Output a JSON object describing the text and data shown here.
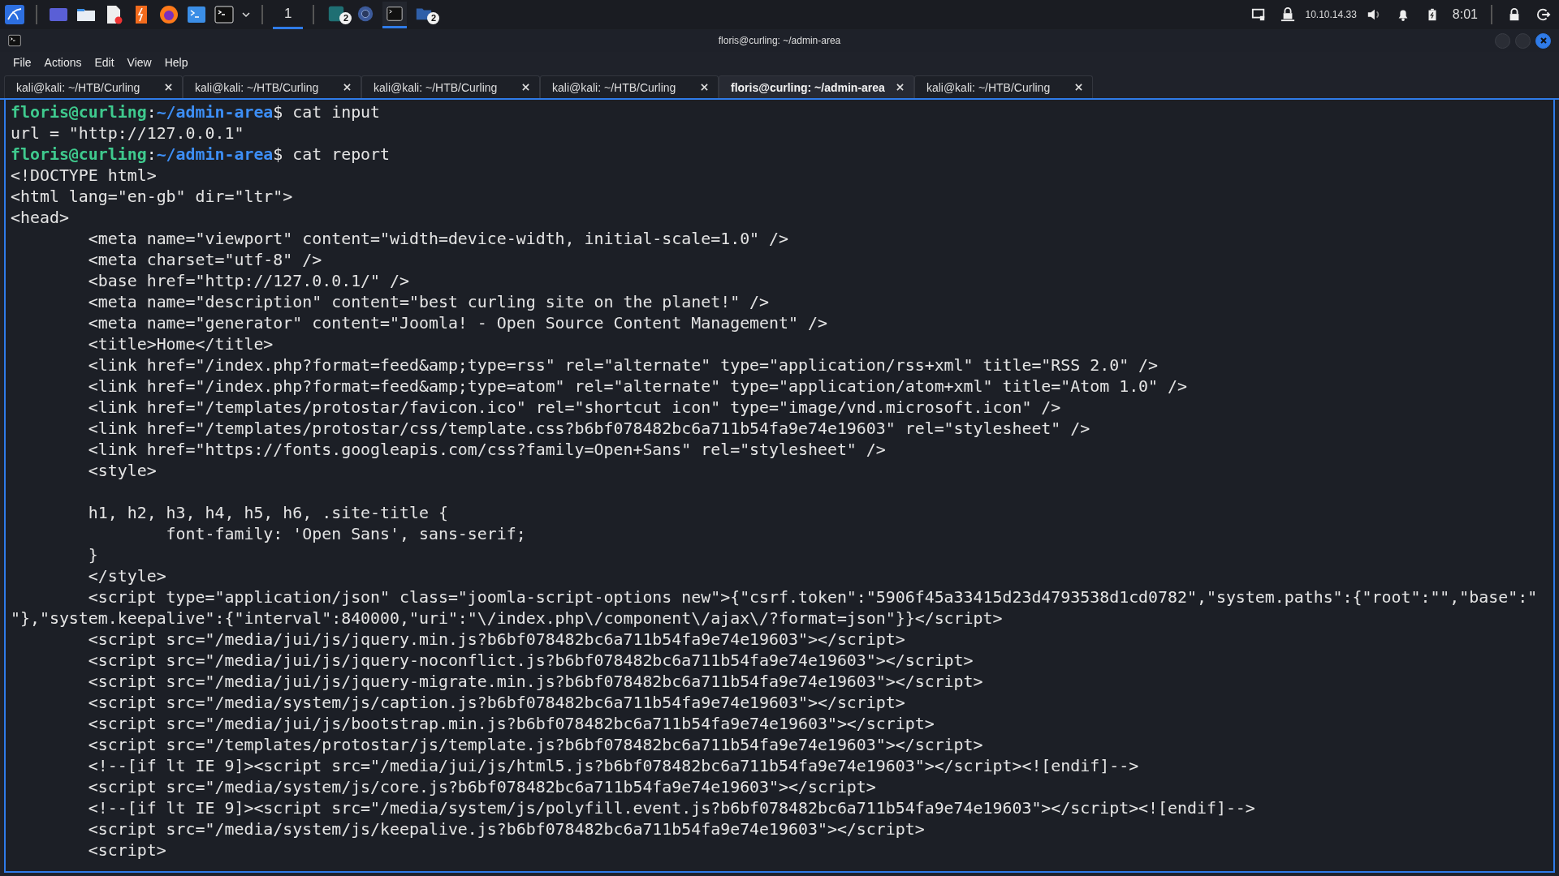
{
  "taskbar": {
    "workspace": "1",
    "tasks": [
      {
        "kind": "app",
        "active": false,
        "badge": "2"
      },
      {
        "kind": "browser",
        "active": false
      },
      {
        "kind": "terminal",
        "active": true
      },
      {
        "kind": "folder",
        "active": false,
        "badge": "2"
      }
    ],
    "tray": {
      "ip": "10.10.14.33",
      "clock": "8:01"
    }
  },
  "window": {
    "title": "floris@curling: ~/admin-area"
  },
  "menu": [
    "File",
    "Actions",
    "Edit",
    "View",
    "Help"
  ],
  "tabs": [
    {
      "label": "kali@kali: ~/HTB/Curling",
      "selected": false
    },
    {
      "label": "kali@kali: ~/HTB/Curling",
      "selected": false
    },
    {
      "label": "kali@kali: ~/HTB/Curling",
      "selected": false
    },
    {
      "label": "kali@kali: ~/HTB/Curling",
      "selected": false
    },
    {
      "label": "floris@curling: ~/admin-area",
      "selected": true
    },
    {
      "label": "kali@kali: ~/HTB/Curling",
      "selected": false
    }
  ],
  "terminal": {
    "lines": [
      {
        "kind": "prompt",
        "user": "floris@curling",
        "sep": ":",
        "path": "~/admin-area",
        "command": "$ cat input"
      },
      {
        "kind": "output",
        "text": "url = \"http://127.0.0.1\""
      },
      {
        "kind": "prompt",
        "user": "floris@curling",
        "sep": ":",
        "path": "~/admin-area",
        "command": "$ cat report"
      },
      {
        "kind": "output",
        "text": "<!DOCTYPE html>"
      },
      {
        "kind": "output",
        "text": "<html lang=\"en-gb\" dir=\"ltr\">"
      },
      {
        "kind": "output",
        "text": "<head>"
      },
      {
        "kind": "output",
        "text": "        <meta name=\"viewport\" content=\"width=device-width, initial-scale=1.0\" />"
      },
      {
        "kind": "output",
        "text": "        <meta charset=\"utf-8\" />"
      },
      {
        "kind": "output",
        "text": "        <base href=\"http://127.0.0.1/\" />"
      },
      {
        "kind": "output",
        "text": "        <meta name=\"description\" content=\"best curling site on the planet!\" />"
      },
      {
        "kind": "output",
        "text": "        <meta name=\"generator\" content=\"Joomla! - Open Source Content Management\" />"
      },
      {
        "kind": "output",
        "text": "        <title>Home</title>"
      },
      {
        "kind": "output",
        "text": "        <link href=\"/index.php?format=feed&amp;type=rss\" rel=\"alternate\" type=\"application/rss+xml\" title=\"RSS 2.0\" />"
      },
      {
        "kind": "output",
        "text": "        <link href=\"/index.php?format=feed&amp;type=atom\" rel=\"alternate\" type=\"application/atom+xml\" title=\"Atom 1.0\" />"
      },
      {
        "kind": "output",
        "text": "        <link href=\"/templates/protostar/favicon.ico\" rel=\"shortcut icon\" type=\"image/vnd.microsoft.icon\" />"
      },
      {
        "kind": "output",
        "text": "        <link href=\"/templates/protostar/css/template.css?b6bf078482bc6a711b54fa9e74e19603\" rel=\"stylesheet\" />"
      },
      {
        "kind": "output",
        "text": "        <link href=\"https://fonts.googleapis.com/css?family=Open+Sans\" rel=\"stylesheet\" />"
      },
      {
        "kind": "output",
        "text": "        <style>"
      },
      {
        "kind": "blank"
      },
      {
        "kind": "output",
        "text": "        h1, h2, h3, h4, h5, h6, .site-title {"
      },
      {
        "kind": "output",
        "text": "                font-family: 'Open Sans', sans-serif;"
      },
      {
        "kind": "output",
        "text": "        }"
      },
      {
        "kind": "output",
        "text": "        </style>"
      },
      {
        "kind": "output",
        "text": "        <script type=\"application/json\" class=\"joomla-script-options new\">{\"csrf.token\":\"5906f45a33415d23d4793538d1cd0782\",\"system.paths\":{\"root\":\"\",\"base\":\""
      },
      {
        "kind": "output",
        "text": "\"},\"system.keepalive\":{\"interval\":840000,\"uri\":\"\\/index.php\\/component\\/ajax\\/?format=json\"}}</script>"
      },
      {
        "kind": "output",
        "text": "        <script src=\"/media/jui/js/jquery.min.js?b6bf078482bc6a711b54fa9e74e19603\"></script>"
      },
      {
        "kind": "output",
        "text": "        <script src=\"/media/jui/js/jquery-noconflict.js?b6bf078482bc6a711b54fa9e74e19603\"></script>"
      },
      {
        "kind": "output",
        "text": "        <script src=\"/media/jui/js/jquery-migrate.min.js?b6bf078482bc6a711b54fa9e74e19603\"></script>"
      },
      {
        "kind": "output",
        "text": "        <script src=\"/media/system/js/caption.js?b6bf078482bc6a711b54fa9e74e19603\"></script>"
      },
      {
        "kind": "output",
        "text": "        <script src=\"/media/jui/js/bootstrap.min.js?b6bf078482bc6a711b54fa9e74e19603\"></script>"
      },
      {
        "kind": "output",
        "text": "        <script src=\"/templates/protostar/js/template.js?b6bf078482bc6a711b54fa9e74e19603\"></script>"
      },
      {
        "kind": "output",
        "text": "        <!--[if lt IE 9]><script src=\"/media/jui/js/html5.js?b6bf078482bc6a711b54fa9e74e19603\"></script><![endif]-->"
      },
      {
        "kind": "output",
        "text": "        <script src=\"/media/system/js/core.js?b6bf078482bc6a711b54fa9e74e19603\"></script>"
      },
      {
        "kind": "output",
        "text": "        <!--[if lt IE 9]><script src=\"/media/system/js/polyfill.event.js?b6bf078482bc6a711b54fa9e74e19603\"></script><![endif]-->"
      },
      {
        "kind": "output",
        "text": "        <script src=\"/media/system/js/keepalive.js?b6bf078482bc6a711b54fa9e74e19603\"></script>"
      },
      {
        "kind": "output",
        "text": "        <script>"
      }
    ]
  }
}
